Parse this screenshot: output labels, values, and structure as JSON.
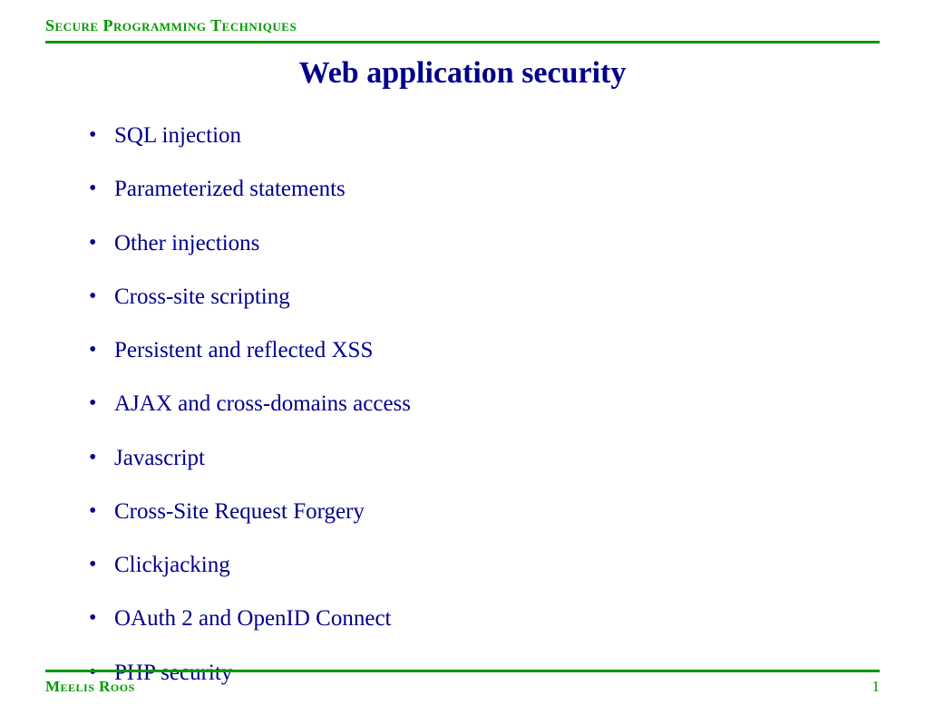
{
  "header": {
    "course_label": "Secure Programming Techniques"
  },
  "title": "Web application security",
  "bullets": [
    "SQL injection",
    "Parameterized statements",
    "Other injections",
    "Cross-site scripting",
    "Persistent and reflected XSS",
    "AJAX and cross-domains access",
    "Javascript",
    "Cross-Site Request Forgery",
    "Clickjacking",
    "OAuth 2 and OpenID Connect",
    "PHP security"
  ],
  "footer": {
    "author": "Meelis Roos",
    "page_number": "1"
  }
}
